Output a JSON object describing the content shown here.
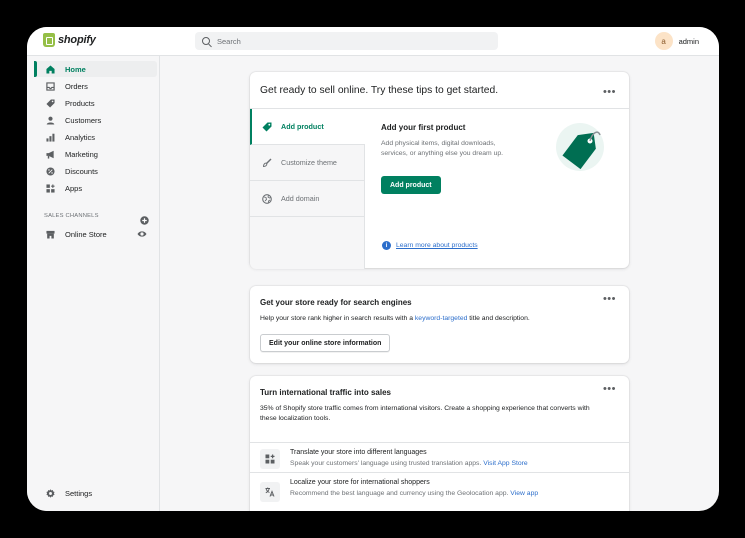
{
  "topbar": {
    "logo_text": "shopify",
    "search_placeholder": "Search",
    "user_initial": "a",
    "user_name": "admin"
  },
  "sidebar": {
    "items": [
      {
        "label": "Home",
        "icon": "home-icon"
      },
      {
        "label": "Orders",
        "icon": "orders-icon"
      },
      {
        "label": "Products",
        "icon": "tag-icon"
      },
      {
        "label": "Customers",
        "icon": "person-icon"
      },
      {
        "label": "Analytics",
        "icon": "bar-chart-icon"
      },
      {
        "label": "Marketing",
        "icon": "megaphone-icon"
      },
      {
        "label": "Discounts",
        "icon": "discount-icon"
      },
      {
        "label": "Apps",
        "icon": "apps-icon"
      }
    ],
    "section_label": "SALES CHANNELS",
    "online_store": "Online Store",
    "settings": "Settings"
  },
  "colors": {
    "accent": "#008060",
    "link": "#2c6ecb"
  },
  "card1": {
    "title": "Get ready to sell online. Try these tips to get started.",
    "tabs": [
      "Add product",
      "Customize theme",
      "Add domain"
    ],
    "panel_title": "Add your first product",
    "panel_text": "Add physical items, digital downloads, services, or anything else you dream up.",
    "button": "Add product",
    "learn_more": "Learn more about products"
  },
  "card2": {
    "title": "Get your store ready for search engines",
    "text_before": "Help your store rank higher in search results with a",
    "text_link": "keyword-targeted",
    "text_after": "title and description.",
    "button": "Edit your online store information"
  },
  "card3": {
    "title": "Turn international traffic into sales",
    "text": "35% of Shopify store traffic comes from international visitors. Create a shopping experience that converts with these localization tools.",
    "rows": [
      {
        "title": "Translate your store into different languages",
        "text": "Speak your customers' language using trusted translation apps.",
        "link": "Visit App Store"
      },
      {
        "title": "Localize your store for international shoppers",
        "text": "Recommend the best language and currency using the Geolocation app.",
        "link": "View app"
      }
    ]
  }
}
